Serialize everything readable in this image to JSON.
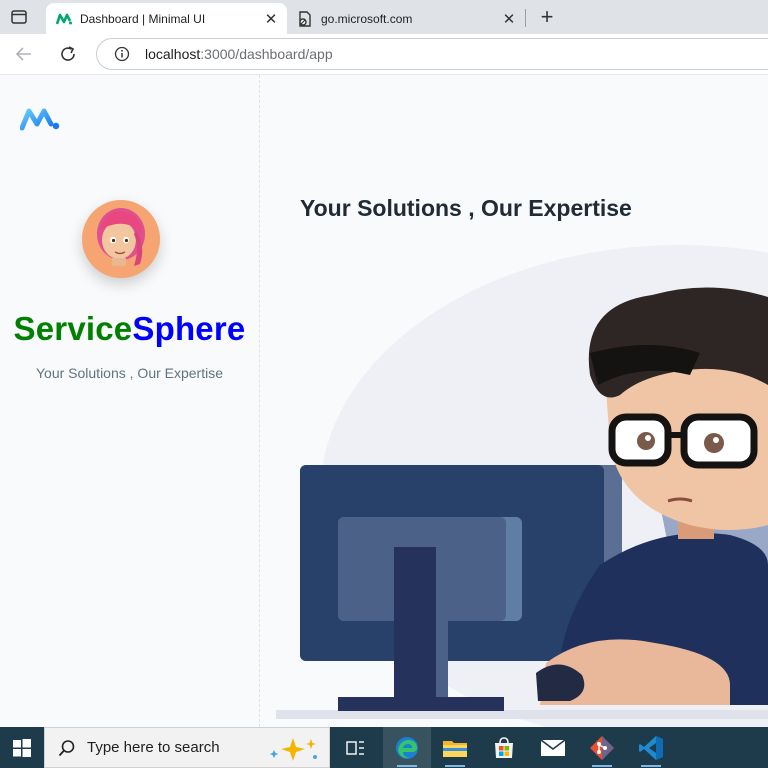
{
  "browser": {
    "tabs": [
      {
        "title": "Dashboard | Minimal UI",
        "active": true
      },
      {
        "title": "go.microsoft.com",
        "active": false
      }
    ],
    "new_tab_symbol": "+",
    "address": {
      "host": "localhost",
      "path": ":3000/dashboard/app"
    }
  },
  "sidebar": {
    "brand_part1": "Service",
    "brand_part2": "Sphere",
    "brand_part1_color": "#008000",
    "brand_part2_color": "#0000ff",
    "tagline": "Your Solutions , Our Expertise"
  },
  "main": {
    "headline": "Your Solutions , Our Expertise"
  },
  "taskbar": {
    "search_placeholder": "Type here to search",
    "apps": [
      "task-view-icon",
      "edge-icon",
      "file-explorer-icon",
      "microsoft-store-icon",
      "mail-icon",
      "git-icon",
      "vscode-icon"
    ]
  },
  "colors": {
    "accent_logo": "#1877f2",
    "taskbar_bg": "#1d3b4a",
    "headline": "#212b36"
  }
}
